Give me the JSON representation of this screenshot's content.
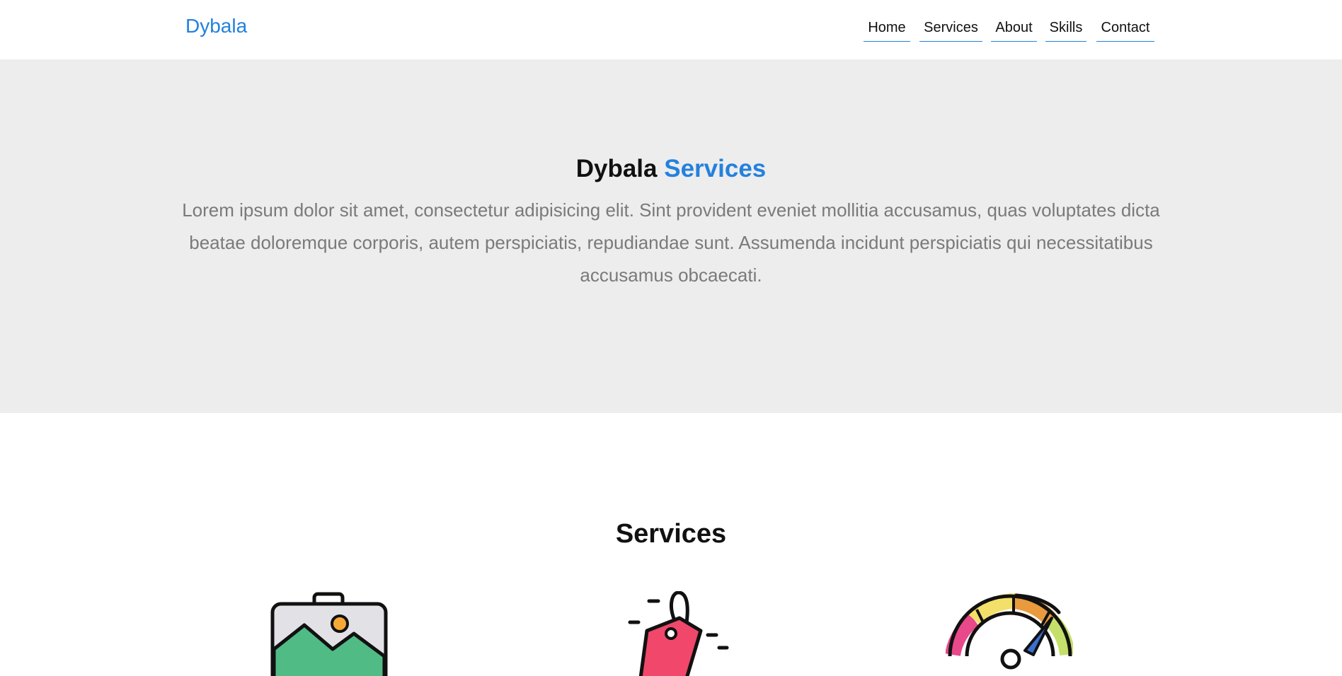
{
  "header": {
    "logo": "Dybala",
    "nav": [
      "Home",
      "Services",
      "About",
      "Skills",
      "Contact"
    ]
  },
  "hero": {
    "title_prefix": "Dybala",
    "title_accent": "Services",
    "text": "Lorem ipsum dolor sit amet, consectetur adipisicing elit. Sint provident eveniet mollitia accusamus, quas voluptates dicta beatae doloremque corporis, autem perspiciatis, repudiandae sunt. Assumenda incidunt perspiciatis qui necessitatibus accusamus obcaecati."
  },
  "services": {
    "title": "Services",
    "icons": [
      "image-gallery-icon",
      "price-tag-icon",
      "speedometer-icon"
    ]
  },
  "colors": {
    "accent": "#2381dd",
    "hero_background": "#ededed",
    "muted_text": "#7a7a7a"
  }
}
